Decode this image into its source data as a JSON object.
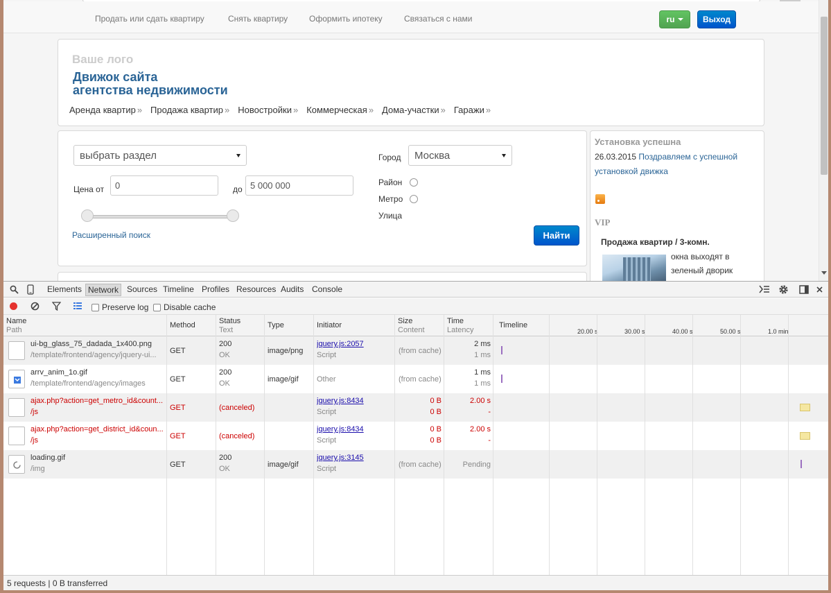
{
  "site": {
    "top_nav": [
      "Продать или сдать квартиру",
      "Снять квартиру",
      "Оформить ипотеку",
      "Связаться с нами"
    ],
    "lang_button": "ru",
    "exit_button": "Выход",
    "logo": "Ваше лого",
    "title_line1": "Движок сайта",
    "title_line2": "агентства недвижимости",
    "categories": [
      "Аренда квартир",
      "Продажа квартир",
      "Новостройки",
      "Коммерческая",
      "Дома-участки",
      "Гаражи"
    ],
    "category_suffix": "»",
    "search": {
      "section_select": "выбрать раздел",
      "price_from_label": "Цена от",
      "price_from_value": "0",
      "price_to_label": "до",
      "price_to_value": "5 000 000",
      "city_label": "Город",
      "city_value": "Москва",
      "district_label": "Район",
      "metro_label": "Метро",
      "street_label": "Улица",
      "advanced_link": "Расширенный поиск",
      "find_button": "Найти"
    },
    "sidebar": {
      "news_title": "Установка успешна",
      "news_date": "26.03.2015",
      "news_link": "Поздравляем с успешной установкой движка",
      "vip_title": "VIP",
      "vip_item_title": "Продажа квартир / 3-комн.",
      "vip_item_desc": "окна выходят в зеленый дворик"
    }
  },
  "devtools": {
    "tabs": [
      "Elements",
      "Network",
      "Sources",
      "Timeline",
      "Profiles",
      "Resources",
      "Audits",
      "Console"
    ],
    "active_tab": "Network",
    "preserve_log": "Preserve log",
    "disable_cache": "Disable cache",
    "headers": {
      "name": "Name",
      "path": "Path",
      "method": "Method",
      "status": "Status",
      "text": "Text",
      "type": "Type",
      "initiator": "Initiator",
      "size": "Size",
      "content": "Content",
      "time": "Time",
      "latency": "Latency",
      "timeline": "Timeline"
    },
    "timeline_ticks": [
      "20.00 s",
      "30.00 s",
      "40.00 s",
      "50.00 s",
      "1.0 min"
    ],
    "requests": [
      {
        "name": "ui-bg_glass_75_dadada_1x400.png",
        "path": "/template/frontend/agency/jquery-ui...",
        "method": "GET",
        "status": "200",
        "status_text": "OK",
        "type": "image/png",
        "initiator": "jquery.js:2057",
        "initiator_type": "Script",
        "size": "(from cache)",
        "content": "",
        "time": "2 ms",
        "latency": "1 ms"
      },
      {
        "name": "arrv_anim_1o.gif",
        "path": "/template/frontend/agency/images",
        "method": "GET",
        "status": "200",
        "status_text": "OK",
        "type": "image/gif",
        "initiator": "",
        "initiator_type": "Other",
        "size": "(from cache)",
        "content": "",
        "time": "1 ms",
        "latency": "1 ms"
      },
      {
        "name": "ajax.php?action=get_metro_id&count...",
        "path": "/js",
        "method": "GET",
        "status": "(canceled)",
        "status_text": "",
        "type": "",
        "initiator": "jquery.js:8434",
        "initiator_type": "Script",
        "size": "0 B",
        "content": "0 B",
        "time": "2.00 s",
        "latency": "-"
      },
      {
        "name": "ajax.php?action=get_district_id&coun...",
        "path": "/js",
        "method": "GET",
        "status": "(canceled)",
        "status_text": "",
        "type": "",
        "initiator": "jquery.js:8434",
        "initiator_type": "Script",
        "size": "0 B",
        "content": "0 B",
        "time": "2.00 s",
        "latency": "-"
      },
      {
        "name": "loading.gif",
        "path": "/img",
        "method": "GET",
        "status": "200",
        "status_text": "OK",
        "type": "image/gif",
        "initiator": "jquery.js:3145",
        "initiator_type": "Script",
        "size": "(from cache)",
        "content": "",
        "time": "Pending",
        "latency": ""
      }
    ],
    "status_bar": "5 requests | 0 B transferred",
    "colors": {
      "error": "#cc0000",
      "timeline_mark": "#9b6fc0",
      "timeline_box": "#f5e7a1"
    }
  }
}
